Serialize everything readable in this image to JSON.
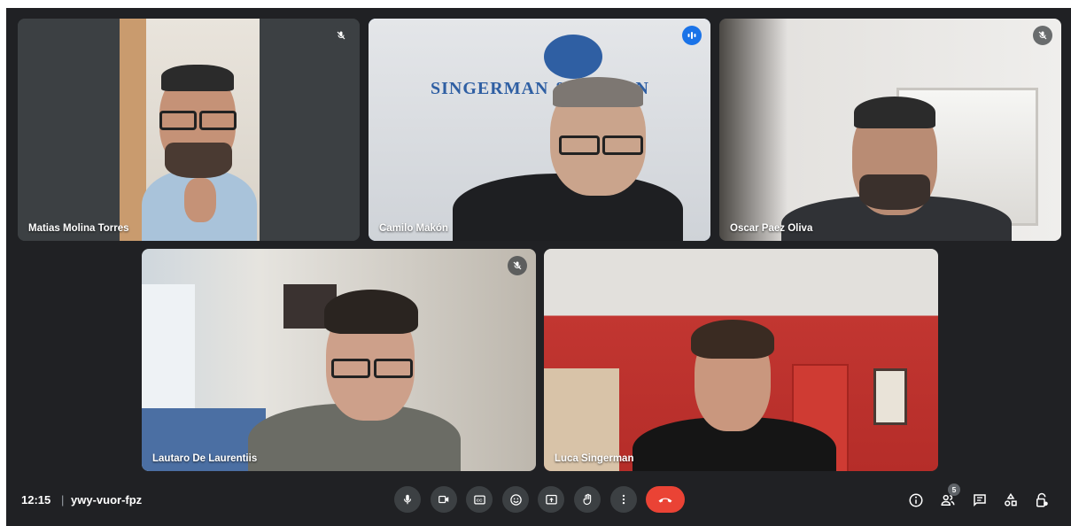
{
  "participants": [
    {
      "name": "Matias Molina Torres",
      "muted": true
    },
    {
      "name": "Camilo Makón",
      "speaking": true,
      "background_text": "SINGERMAN & MAKON"
    },
    {
      "name": "Oscar Paez Oliva",
      "muted": true
    },
    {
      "name": "Lautaro De Laurentiis",
      "muted": true
    },
    {
      "name": "Luca Singerman",
      "muted": false
    }
  ],
  "meeting": {
    "time": "12:15",
    "separator": "|",
    "code": "ywy-vuor-fpz"
  },
  "controls": [
    "mic-icon",
    "camera-icon",
    "captions-icon",
    "emoji-icon",
    "present-icon",
    "raise-hand-icon",
    "more-options-icon",
    "end-call-icon"
  ],
  "right_controls": {
    "people_count": "5"
  },
  "colors": {
    "background": "#202124",
    "active_border": "#8ab4f8",
    "speaking_badge": "#1a73e8",
    "end_call": "#ea4335",
    "control": "#3c4043"
  }
}
